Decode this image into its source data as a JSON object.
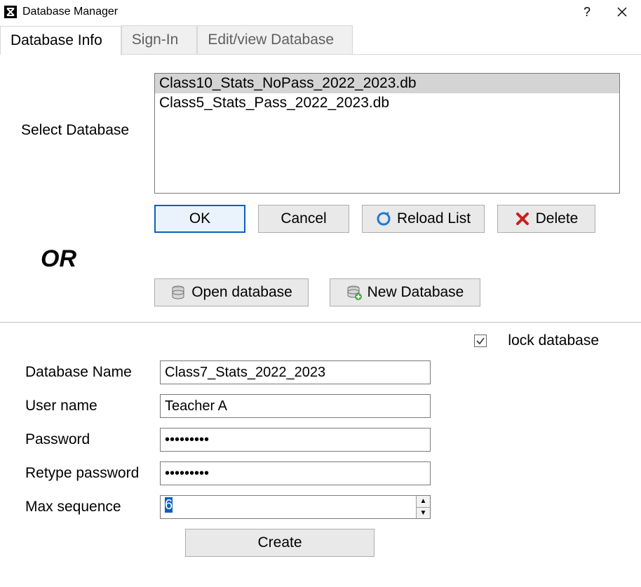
{
  "window": {
    "title": "Database Manager"
  },
  "tabs": [
    {
      "label": "Database Info",
      "active": true
    },
    {
      "label": "Sign-In",
      "active": false
    },
    {
      "label": "Edit/view Database",
      "active": false
    }
  ],
  "select_db": {
    "label": "Select Database",
    "items": [
      {
        "name": "Class10_Stats_NoPass_2022_2023.db",
        "selected": true
      },
      {
        "name": "Class5_Stats_Pass_2022_2023.db",
        "selected": false
      }
    ],
    "buttons": {
      "ok": "OK",
      "cancel": "Cancel",
      "reload": "Reload List",
      "delete": "Delete"
    }
  },
  "or_label": "OR",
  "db_buttons": {
    "open": "Open database",
    "new": "New Database"
  },
  "lock": {
    "checked": true,
    "label": "lock database"
  },
  "form": {
    "dbname_label": "Database Name",
    "dbname_value": "Class7_Stats_2022_2023",
    "user_label": "User name",
    "user_value": "Teacher A",
    "pass_label": "Password",
    "pass_value": "•••••••••",
    "repass_label": "Retype password",
    "repass_value": "•••••••••",
    "maxseq_label": "Max sequence",
    "maxseq_value": "6",
    "create": "Create"
  }
}
